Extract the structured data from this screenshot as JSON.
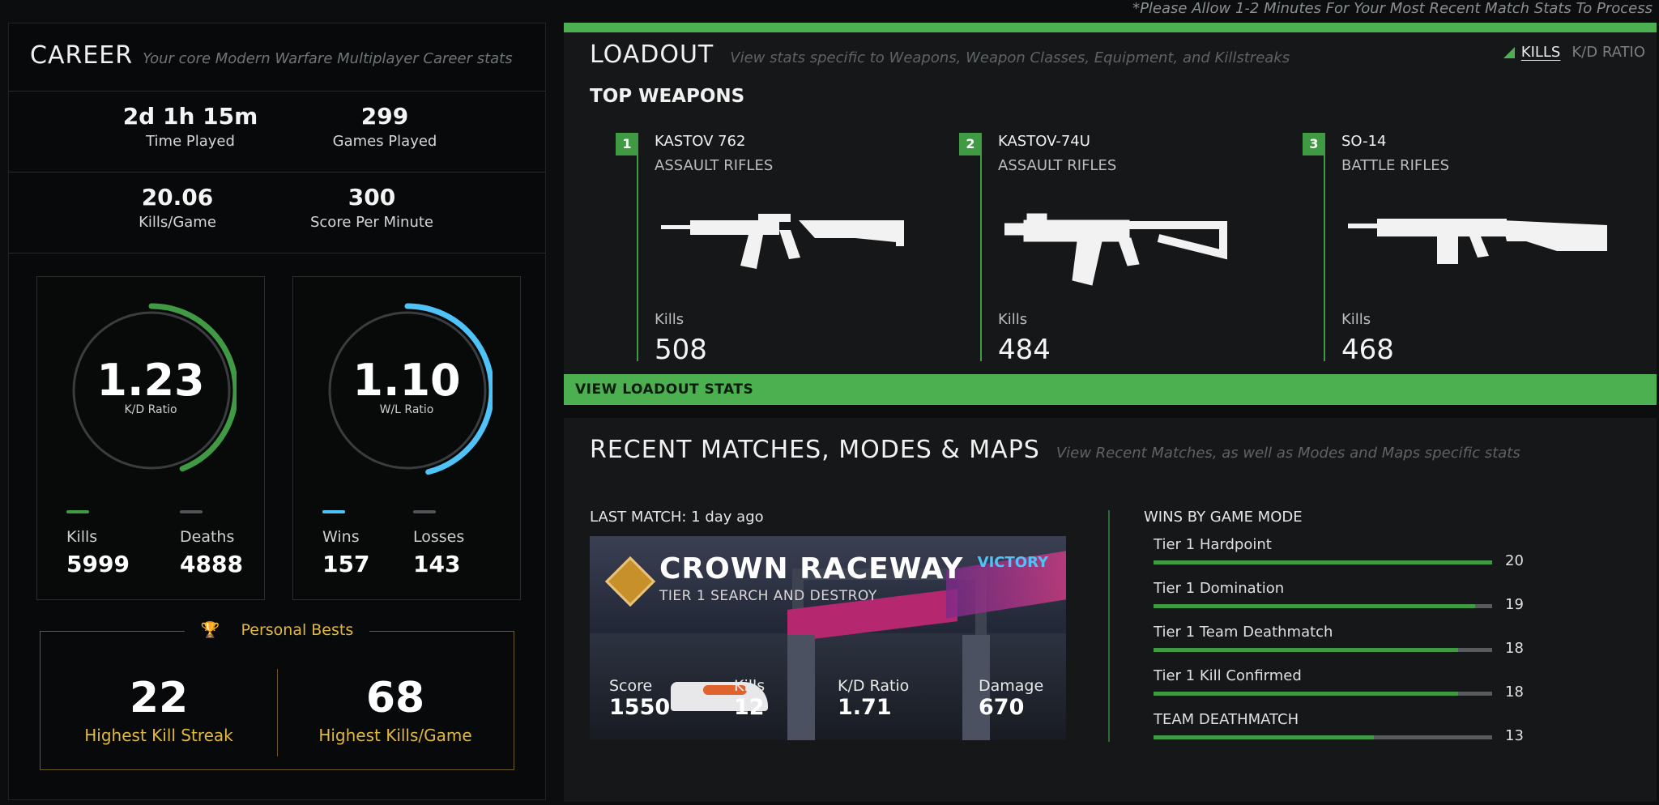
{
  "notice": "*Please Allow 1-2 Minutes For Your Most Recent Match Stats To Process",
  "career": {
    "title": "CAREER",
    "subtitle": "Your core Modern Warfare Multiplayer Career stats",
    "time_played": {
      "value": "2d 1h 15m",
      "label": "Time Played"
    },
    "games_played": {
      "value": "299",
      "label": "Games Played"
    },
    "kills_per_game": {
      "value": "20.06",
      "label": "Kills/Game"
    },
    "score_per_minute": {
      "value": "300",
      "label": "Score Per Minute"
    },
    "kd": {
      "value": "1.23",
      "label": "K/D Ratio",
      "color": "#3f9a43",
      "progress": 0.44,
      "left_label": "Kills",
      "left_value": "5999",
      "right_label": "Deaths",
      "right_value": "4888"
    },
    "wl": {
      "value": "1.10",
      "label": "W/L Ratio",
      "color": "#4fc3f7",
      "progress": 0.46,
      "left_label": "Wins",
      "left_value": "157",
      "right_label": "Losses",
      "right_value": "143"
    },
    "personal_bests": {
      "title": "Personal Bests",
      "items": [
        {
          "value": "22",
          "label": "Highest Kill Streak"
        },
        {
          "value": "68",
          "label": "Highest Kills/Game"
        }
      ]
    }
  },
  "loadout": {
    "title": "LOADOUT",
    "subtitle": "View stats specific to Weapons, Weapon Classes, Equipment, and Killstreaks",
    "toggle_active": "KILLS",
    "toggle_inactive": "K/D RATIO",
    "top_weapons_label": "TOP WEAPONS",
    "weapons": [
      {
        "rank": "1",
        "name": "KASTOV 762",
        "class": "ASSAULT RIFLES",
        "kills_label": "Kills",
        "kills": "508"
      },
      {
        "rank": "2",
        "name": "KASTOV-74U",
        "class": "ASSAULT RIFLES",
        "kills_label": "Kills",
        "kills": "484"
      },
      {
        "rank": "3",
        "name": "SO-14",
        "class": "BATTLE RIFLES",
        "kills_label": "Kills",
        "kills": "468"
      }
    ],
    "view_button": "VIEW LOADOUT STATS"
  },
  "recent": {
    "title": "RECENT MATCHES, MODES & MAPS",
    "subtitle": "View Recent Matches, as well as Modes and Maps specific stats",
    "last_match_label": "LAST MATCH: 1 day ago",
    "match": {
      "map": "CROWN RACEWAY",
      "mode": "TIER 1 SEARCH AND DESTROY",
      "result": "VICTORY",
      "stats": [
        {
          "label": "Score",
          "value": "1550"
        },
        {
          "label": "Kills",
          "value": "12"
        },
        {
          "label": "K/D Ratio",
          "value": "1.71"
        },
        {
          "label": "Damage",
          "value": "670"
        }
      ]
    },
    "wins_by_mode_label": "WINS BY GAME MODE",
    "modes": [
      {
        "name": "Tier 1 Hardpoint",
        "wins": "20",
        "fraction": 1.0
      },
      {
        "name": "Tier 1 Domination",
        "wins": "19",
        "fraction": 0.95
      },
      {
        "name": "Tier 1 Team Deathmatch",
        "wins": "18",
        "fraction": 0.9
      },
      {
        "name": "Tier 1 Kill Confirmed",
        "wins": "18",
        "fraction": 0.9
      },
      {
        "name": "TEAM DEATHMATCH",
        "wins": "13",
        "fraction": 0.65
      }
    ]
  }
}
